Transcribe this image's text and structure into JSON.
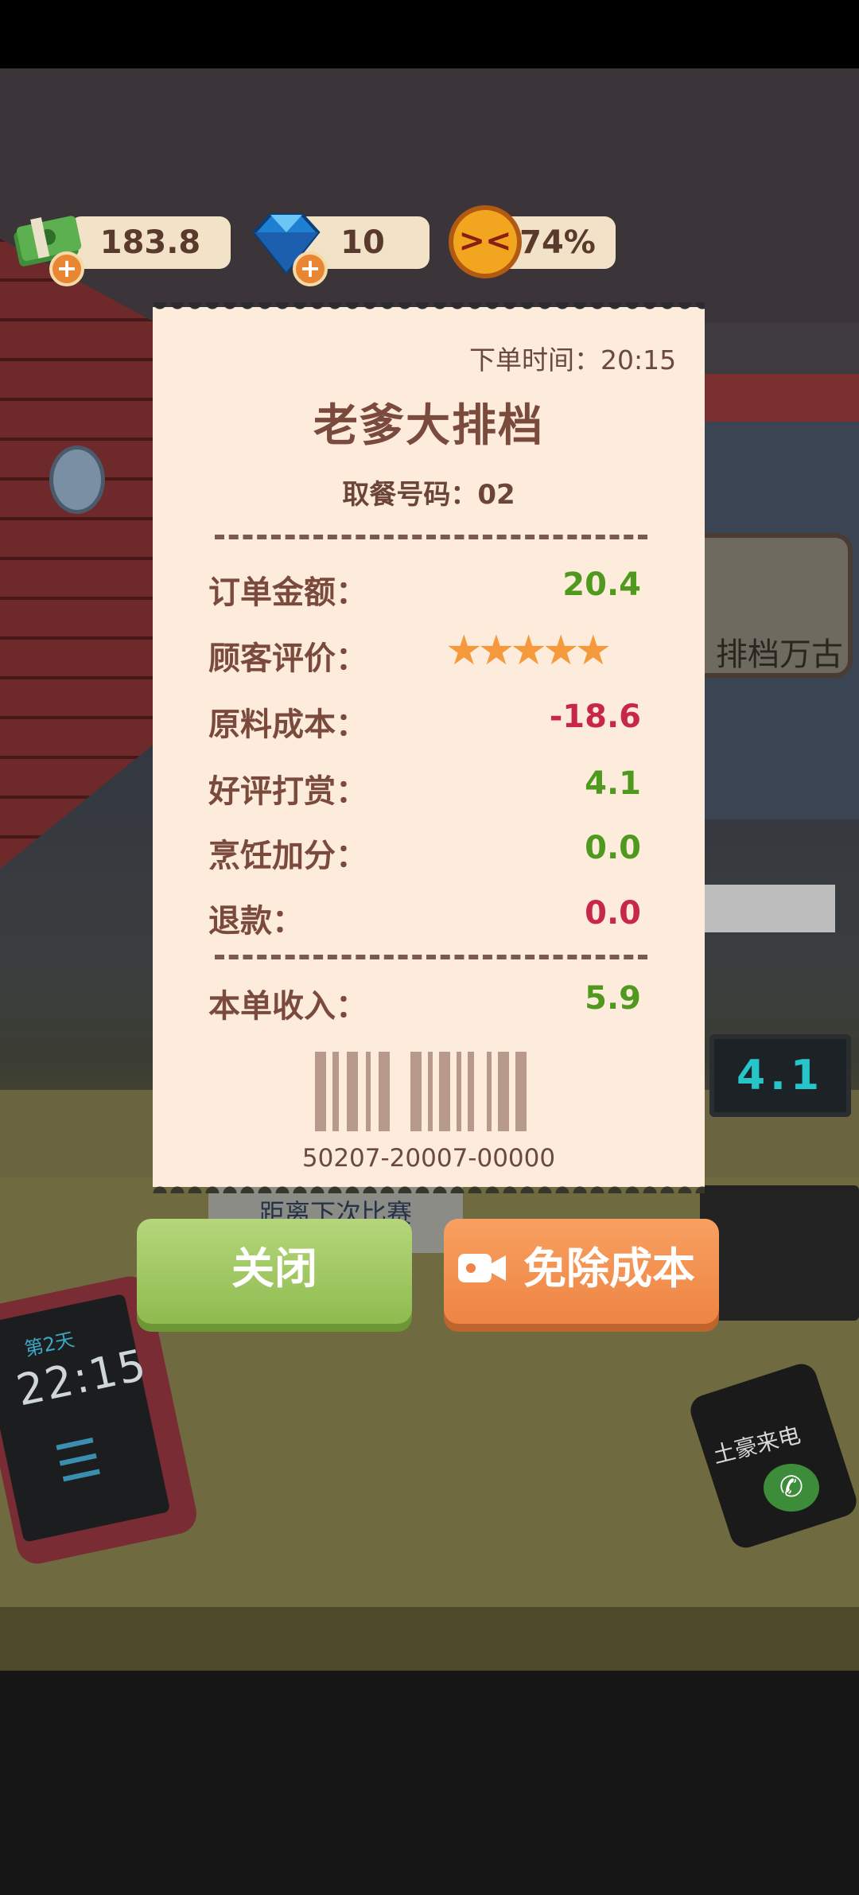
{
  "hud": {
    "money": "183.8",
    "gems": "10",
    "mood": "74%",
    "plus_symbol": "+"
  },
  "scene": {
    "sign_text": "排档万古",
    "score_display": "4.1",
    "next_match_text": "距离下次比赛",
    "tablet_day": "第2天",
    "tablet_time": "22:15",
    "tablet_menu_icon": "list-icon",
    "phone_label": "土豪来电",
    "phone_call_icon": "phone-icon"
  },
  "receipt": {
    "order_time": "下单时间：20:15",
    "shop_name": "老爹大排档",
    "pickup_number": "取餐号码：02",
    "rows": [
      {
        "label": "订单金额：",
        "value": "20.4",
        "color": "#4f9a1e"
      },
      {
        "label": "顾客评价：",
        "stars": 5
      },
      {
        "label": "原料成本：",
        "value": "-18.6",
        "color": "#c72848"
      },
      {
        "label": "好评打赏：",
        "value": "4.1",
        "color": "#4f9a1e"
      },
      {
        "label": "烹饪加分：",
        "value": "0.0",
        "color": "#4f9a1e"
      },
      {
        "label": "退款：",
        "value": "0.0",
        "color": "#c72848"
      }
    ],
    "income_label": "本单收入：",
    "income_value": "5.9",
    "star_glyphs": "★★★★★",
    "barcode_number": "50207-20007-00000"
  },
  "buttons": {
    "close": "关闭",
    "remove_cost": "免除成本"
  }
}
